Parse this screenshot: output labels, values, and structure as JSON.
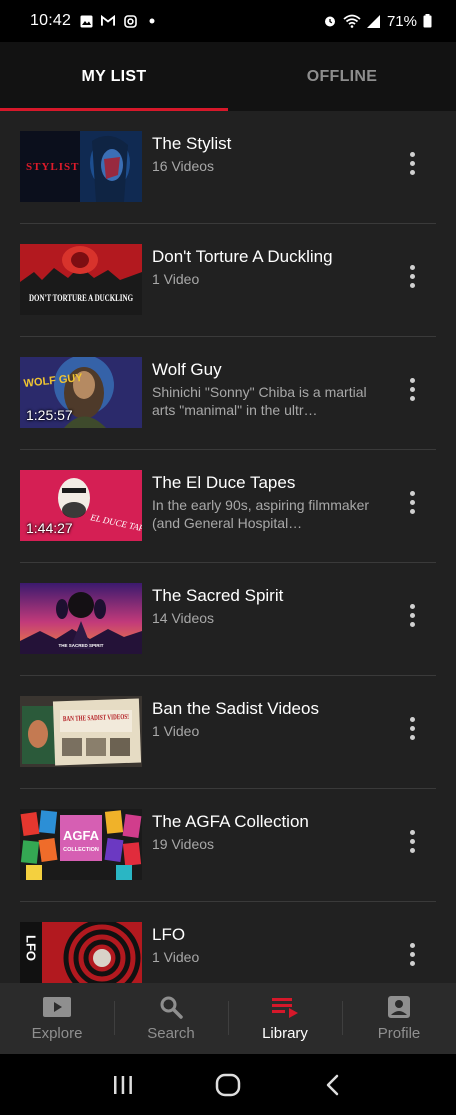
{
  "status_bar": {
    "time": "10:42",
    "notification_icons": [
      "image-icon",
      "gmail-icon",
      "instagram-icon",
      "dot-icon"
    ],
    "system_icons": [
      "alarm-icon",
      "wifi-icon",
      "signal-icon",
      "battery-icon"
    ],
    "battery": "71%"
  },
  "tabs": [
    {
      "label": "MY LIST",
      "active": true
    },
    {
      "label": "OFFLINE",
      "active": false
    }
  ],
  "items": [
    {
      "title": "The Stylist",
      "subtitle": "16 Videos",
      "duration": ""
    },
    {
      "title": "Don't Torture A Duckling",
      "subtitle": "1 Video",
      "duration": ""
    },
    {
      "title": "Wolf Guy",
      "subtitle": "Shinichi \"Sonny\" Chiba is a martial arts \"manimal\" in the ultr…",
      "duration": "1:25:57"
    },
    {
      "title": "The El Duce Tapes",
      "subtitle": "In the early 90s, aspiring filmmaker (and General Hospital…",
      "duration": "1:44:27"
    },
    {
      "title": "The Sacred Spirit",
      "subtitle": "14 Videos",
      "duration": ""
    },
    {
      "title": "Ban the Sadist Videos",
      "subtitle": "1 Video",
      "duration": ""
    },
    {
      "title": "The AGFA Collection",
      "subtitle": "19 Videos",
      "duration": ""
    },
    {
      "title": "LFO",
      "subtitle": "1 Video",
      "duration": ""
    }
  ],
  "thumb_text": {
    "stylist": "STYLIST",
    "duckling": "DON'T TORTURE A DUCKLING",
    "wolf": "WOLF GUY",
    "elduce": "EL DUCE TAPES",
    "sacred": "THE SACRED SPIRIT",
    "sadist": "BAN THE SADIST VIDEOS!",
    "agfa": "AGFA",
    "agfa_sub": "COLLECTION",
    "lfo": "LFO"
  },
  "bottom_nav": [
    {
      "label": "Explore",
      "icon": "play-icon",
      "active": false
    },
    {
      "label": "Search",
      "icon": "search-icon",
      "active": false
    },
    {
      "label": "Library",
      "icon": "library-icon",
      "active": true
    },
    {
      "label": "Profile",
      "icon": "profile-icon",
      "active": false
    }
  ],
  "colors": {
    "accent": "#d6182a",
    "background": "#212121",
    "tab_bar": "#121212",
    "nav_bar": "#2b2b2b"
  }
}
